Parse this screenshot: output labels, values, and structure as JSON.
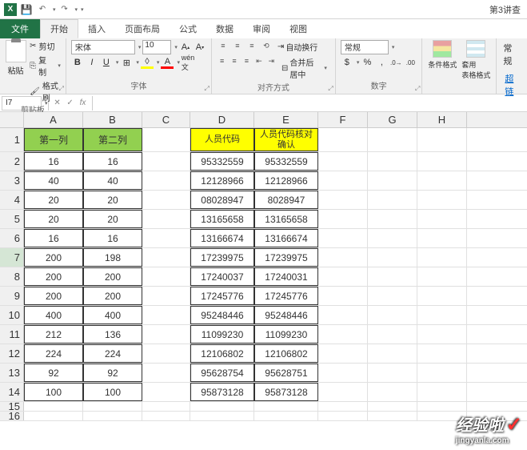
{
  "title": "第3讲查",
  "qat": {
    "undo": "↶",
    "redo": "↷"
  },
  "tabs": {
    "file": "文件",
    "home": "开始",
    "insert": "插入",
    "layout": "页面布局",
    "formula": "公式",
    "data": "数据",
    "review": "审阅",
    "view": "视图"
  },
  "ribbon": {
    "clipboard": {
      "paste": "粘贴",
      "cut": "剪切",
      "copy": "复制",
      "format_painter": "格式刷",
      "label": "剪贴板"
    },
    "font": {
      "name": "宋体",
      "size": "10",
      "label": "字体",
      "bold": "B",
      "italic": "I",
      "underline": "U",
      "grow": "A",
      "shrink": "A"
    },
    "align": {
      "wrap": "自动换行",
      "merge": "合并后居中",
      "label": "对齐方式"
    },
    "number": {
      "format": "常规",
      "label": "数字"
    },
    "styles": {
      "cond": "条件格式",
      "table": "套用\n表格格式",
      "label": ""
    },
    "link": {
      "text": "超链"
    },
    "general": "常规"
  },
  "namebox": "I7",
  "fb": {
    "cancel": "✕",
    "confirm": "✓",
    "fx": "fx"
  },
  "columns": [
    "A",
    "B",
    "C",
    "D",
    "E",
    "F",
    "G",
    "H"
  ],
  "headers": {
    "a": "第一列",
    "b": "第二列",
    "d": "人员代码",
    "e": "人员代码核对确认"
  },
  "rows": [
    {
      "n": "1"
    },
    {
      "n": "2",
      "a": "16",
      "b": "16",
      "d": "95332559",
      "e": "95332559"
    },
    {
      "n": "3",
      "a": "40",
      "b": "40",
      "d": "12128966",
      "e": "12128966"
    },
    {
      "n": "4",
      "a": "20",
      "b": "20",
      "d": "08028947",
      "e": "8028947"
    },
    {
      "n": "5",
      "a": "20",
      "b": "20",
      "d": "13165658",
      "e": "13165658"
    },
    {
      "n": "6",
      "a": "16",
      "b": "16",
      "d": "13166674",
      "e": "13166674"
    },
    {
      "n": "7",
      "a": "200",
      "b": "198",
      "d": "17239975",
      "e": "17239975"
    },
    {
      "n": "8",
      "a": "200",
      "b": "200",
      "d": "17240037",
      "e": "17240031"
    },
    {
      "n": "9",
      "a": "200",
      "b": "200",
      "d": "17245776",
      "e": "17245776"
    },
    {
      "n": "10",
      "a": "400",
      "b": "400",
      "d": "95248446",
      "e": "95248446"
    },
    {
      "n": "11",
      "a": "212",
      "b": "136",
      "d": "11099230",
      "e": "11099230"
    },
    {
      "n": "12",
      "a": "224",
      "b": "224",
      "d": "12106802",
      "e": "12106802"
    },
    {
      "n": "13",
      "a": "92",
      "b": "92",
      "d": "95628754",
      "e": "95628751"
    },
    {
      "n": "14",
      "a": "100",
      "b": "100",
      "d": "95873128",
      "e": "95873128"
    },
    {
      "n": "15"
    },
    {
      "n": "16"
    }
  ],
  "watermark": {
    "big": "经验啦",
    "url": "jingyanla.com"
  }
}
